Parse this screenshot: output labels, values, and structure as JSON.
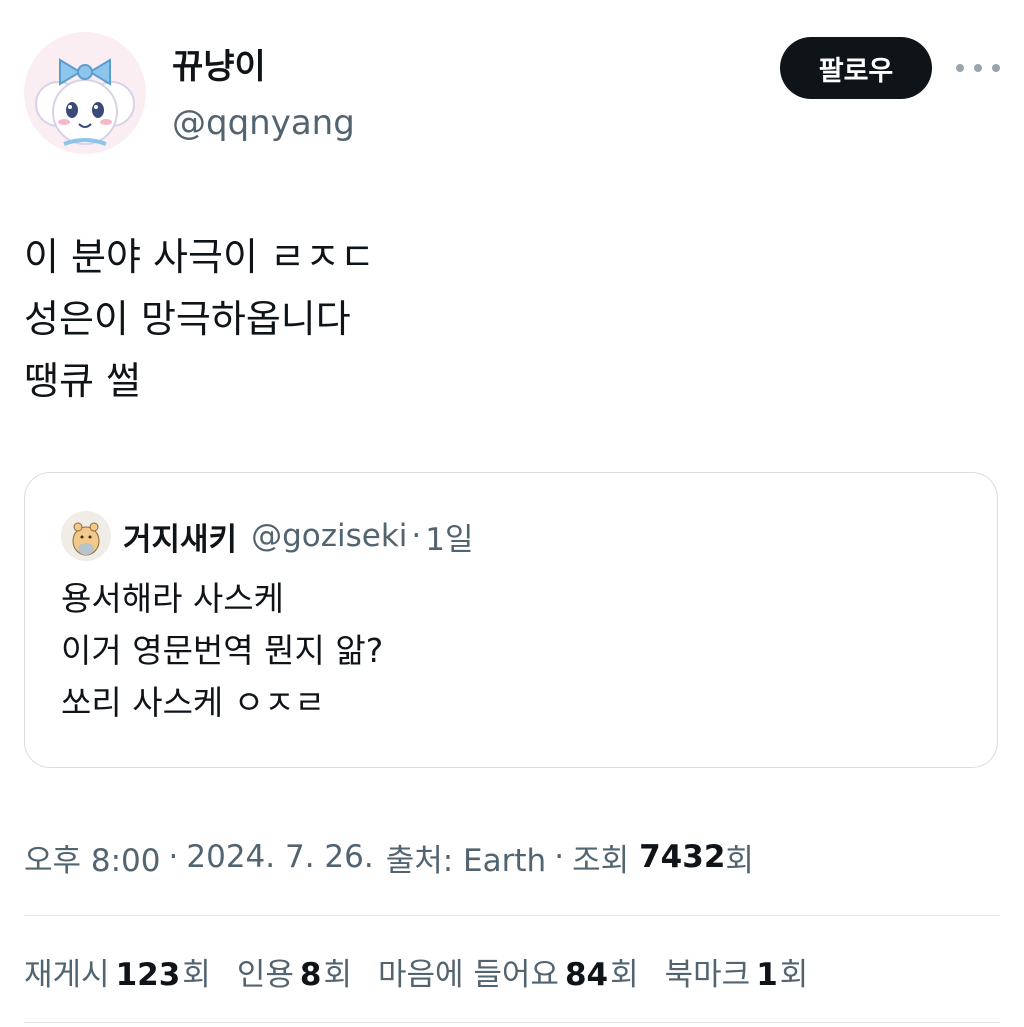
{
  "author": {
    "display_name": "뀨냥이",
    "handle": "@qqnyang",
    "avatar_icon": "pink-sheep-character-avatar"
  },
  "follow_button_label": "팔로우",
  "more_icon": "ellipsis-icon",
  "tweet_lines": [
    "이 분야 사극이 ㄹㅈㄷ",
    "성은이 망극하옵니다",
    "땡큐 썰"
  ],
  "quote": {
    "display_name": "거지새키",
    "handle": "@goziseki",
    "separator": "·",
    "time": "1일",
    "avatar_icon": "hamster-character-avatar",
    "lines": [
      "용서해라 사스케",
      "이거 영문번역 뭔지 앎?",
      "쏘리 사스케 ㅇㅈㄹ"
    ]
  },
  "meta": {
    "time": "오후 8:00",
    "date": "2024. 7. 26.",
    "source": "출처: Earth",
    "separator": "·",
    "views_prefix": "조회",
    "views_count": "7432",
    "views_suffix": "회"
  },
  "stats": {
    "retweets_label": "재게시",
    "retweets_count": "123",
    "quotes_label": "인용",
    "quotes_count": "8",
    "likes_label": "마음에 들어요",
    "likes_count": "84",
    "bookmarks_label": "북마크",
    "bookmarks_count": "1",
    "unit": "회"
  },
  "colors": {
    "text_primary": "#0f1419",
    "text_secondary": "#536471",
    "border": "#d7dde1",
    "follow_bg": "#0f1419"
  }
}
